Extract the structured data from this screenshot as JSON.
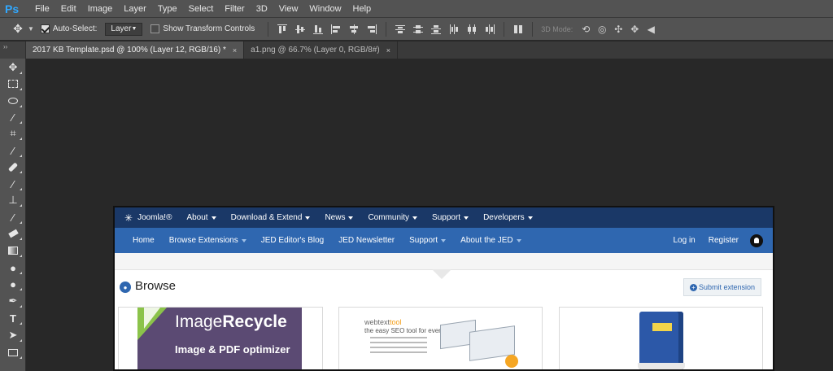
{
  "app": {
    "logo": "Ps",
    "menu": [
      "File",
      "Edit",
      "Image",
      "Layer",
      "Type",
      "Select",
      "Filter",
      "3D",
      "View",
      "Window",
      "Help"
    ]
  },
  "options": {
    "auto_select_label": "Auto-Select:",
    "auto_select_checked": true,
    "auto_select_value": "Layer",
    "transform_label": "Show Transform Controls",
    "transform_checked": false,
    "mode_3d_label": "3D Mode:"
  },
  "tabs": [
    {
      "label": "2017 KB Template.psd @ 100% (Layer 12, RGB/16) *",
      "active": true
    },
    {
      "label": "a1.png @ 66.7% (Layer 0, RGB/8#)",
      "active": false
    }
  ],
  "tab_close": "×",
  "panel_collapse": "››",
  "toolbar": {
    "tools": [
      "move-tool",
      "marquee-tool",
      "lasso-tool",
      "magic-wand-tool",
      "crop-tool",
      "eyedropper-tool",
      "healing-brush-tool",
      "brush-tool",
      "clone-stamp-tool",
      "history-brush-tool",
      "eraser-tool",
      "gradient-tool",
      "blur-tool",
      "dodge-tool",
      "pen-tool",
      "type-tool",
      "path-selection-tool",
      "rectangle-tool"
    ]
  },
  "document": {
    "joomla_bar": {
      "logo": "Joomla!®",
      "items": [
        "About",
        "Download & Extend",
        "News",
        "Community",
        "Support",
        "Developers"
      ]
    },
    "jed_bar": {
      "items": [
        {
          "label": "Home",
          "dropdown": false
        },
        {
          "label": "Browse Extensions",
          "dropdown": true
        },
        {
          "label": "JED Editor's Blog",
          "dropdown": false
        },
        {
          "label": "JED Newsletter",
          "dropdown": false
        },
        {
          "label": "Support",
          "dropdown": true
        },
        {
          "label": "About the JED",
          "dropdown": true
        }
      ],
      "login": "Log in",
      "register": "Register"
    },
    "browse_title": "Browse",
    "submit_label": "Submit extension",
    "cards": {
      "imagerecycle_title_a": "Image",
      "imagerecycle_title_b": "Recycle",
      "imagerecycle_sub": "Image & PDF optimizer",
      "webtexttool_logo_a": "webtext",
      "webtexttool_logo_b": "tool",
      "webtexttool_tag": "the easy SEO tool for everyone!"
    }
  }
}
